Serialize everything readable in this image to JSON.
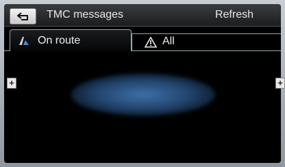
{
  "header": {
    "title": "TMC messages",
    "refresh_label": "Refresh"
  },
  "tabs": [
    {
      "label": "On route",
      "icon": "road-traffic-icon",
      "selected": true
    },
    {
      "label": "All",
      "icon": "warning-triangle-icon",
      "selected": false
    }
  ],
  "map": {
    "zoom_in_left": "+",
    "zoom_in_right": "+"
  },
  "colors": {
    "accent": "#3f6fa8",
    "background": "#000000",
    "text": "#f0f0f0"
  }
}
